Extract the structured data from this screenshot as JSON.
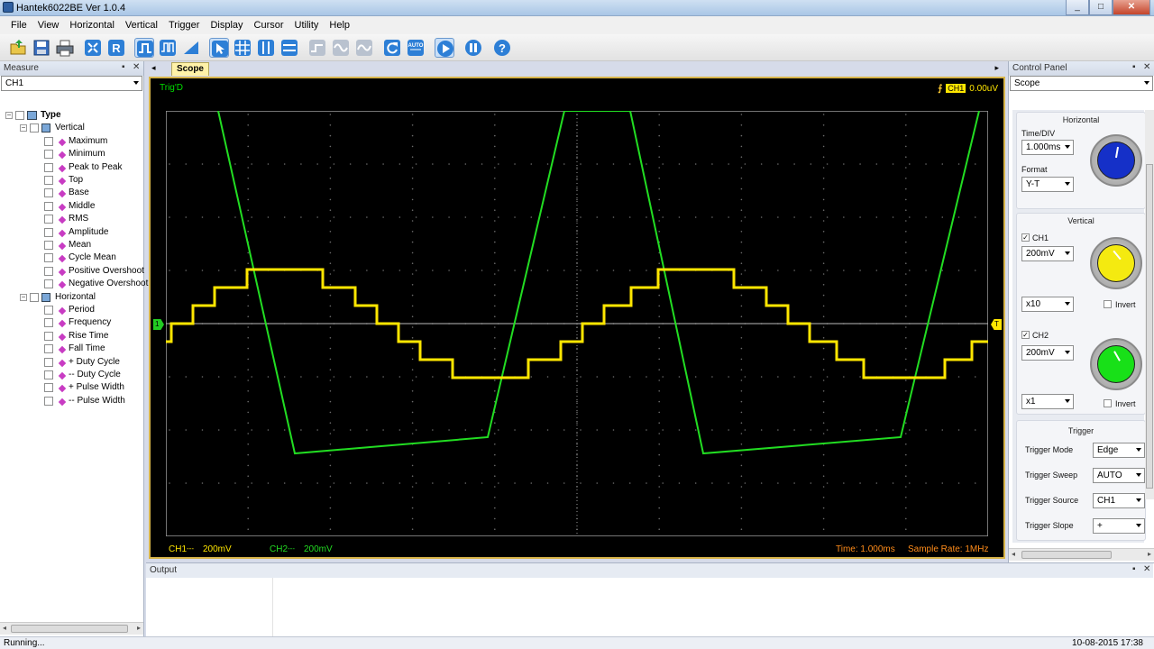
{
  "window": {
    "title": "Hantek6022BE Ver 1.0.4",
    "min": "_",
    "max": "□",
    "close": "✕"
  },
  "menu": [
    "File",
    "View",
    "Horizontal",
    "Vertical",
    "Trigger",
    "Display",
    "Cursor",
    "Utility",
    "Help"
  ],
  "toolbar": {
    "icons": [
      "open-icon",
      "save-icon",
      "print-icon",
      "fit-icon",
      "reset-r-icon",
      "single-pulse-icon",
      "double-pulse-icon",
      "ramp-icon",
      "cursor-select-icon",
      "grid-icon",
      "vertical-cursor-icon",
      "horizontal-cursor-icon",
      "step-wave-icon",
      "sine-wave-icon",
      "triangle-wave-icon",
      "refresh-icon",
      "auto-icon",
      "run-icon",
      "pause-icon",
      "help-icon"
    ]
  },
  "measure": {
    "title": "Measure",
    "channel": "CH1",
    "root": "Type",
    "groups": [
      {
        "label": "Vertical",
        "items": [
          "Maximum",
          "Minimum",
          "Peak to Peak",
          "Top",
          "Base",
          "Middle",
          "RMS",
          "Amplitude",
          "Mean",
          "Cycle Mean",
          "Positive Overshoot",
          "Negative Overshoot"
        ]
      },
      {
        "label": "Horizontal",
        "items": [
          "Period",
          "Frequency",
          "Rise Time",
          "Fall Time",
          "+ Duty Cycle",
          "-- Duty Cycle",
          "+ Pulse Width",
          "-- Pulse Width"
        ]
      }
    ]
  },
  "scope": {
    "tab": "Scope",
    "trig_state": "Trig'D",
    "trig_channel": "CH1",
    "trig_level": "0.00uV",
    "ch1_label": "CH1",
    "ch1_coupling": "---",
    "ch1_scale": "200mV",
    "ch2_label": "CH2",
    "ch2_coupling": "---",
    "ch2_scale": "200mV",
    "time": "Time: 1.000ms",
    "sample_rate": "Sample Rate: 1MHz",
    "ch1_marker": "1",
    "trig_marker": "T",
    "colors": {
      "ch1": "#ffe600",
      "ch2": "#22dd22",
      "grid": "#6b6b6b",
      "frame": "#d8b54a"
    }
  },
  "control_panel": {
    "title": "Control Panel",
    "mode": "Scope",
    "horizontal": {
      "title": "Horizontal",
      "timediv_label": "Time/DIV",
      "timediv": "1.000ms",
      "format_label": "Format",
      "format": "Y-T"
    },
    "vertical": {
      "title": "Vertical",
      "ch1": {
        "label": "CH1",
        "checked": true,
        "volt": "200mV",
        "probe": "x10",
        "invert": "Invert"
      },
      "ch2": {
        "label": "CH2",
        "checked": true,
        "volt": "200mV",
        "probe": "x1",
        "invert": "Invert"
      }
    },
    "trigger": {
      "title": "Trigger",
      "rows": [
        {
          "label": "Trigger Mode",
          "value": "Edge"
        },
        {
          "label": "Trigger Sweep",
          "value": "AUTO"
        },
        {
          "label": "Trigger Source",
          "value": "CH1"
        },
        {
          "label": "Trigger Slope",
          "value": "+"
        }
      ]
    }
  },
  "output": {
    "title": "Output"
  },
  "status": {
    "text": "Running...",
    "datetime": "10-08-2015  17:38"
  }
}
